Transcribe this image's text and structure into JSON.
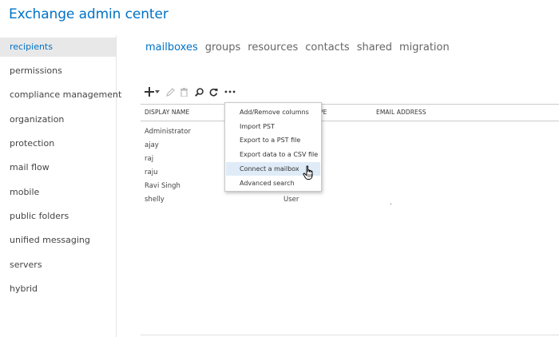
{
  "app": {
    "title": "Exchange admin center"
  },
  "sidebar": {
    "items": [
      {
        "label": "recipients",
        "active": true
      },
      {
        "label": "permissions"
      },
      {
        "label": "compliance management"
      },
      {
        "label": "organization"
      },
      {
        "label": "protection"
      },
      {
        "label": "mail flow"
      },
      {
        "label": "mobile"
      },
      {
        "label": "public folders"
      },
      {
        "label": "unified messaging"
      },
      {
        "label": "servers"
      },
      {
        "label": "hybrid"
      }
    ]
  },
  "tabs": [
    {
      "label": "mailboxes",
      "active": true
    },
    {
      "label": "groups"
    },
    {
      "label": "resources"
    },
    {
      "label": "contacts"
    },
    {
      "label": "shared"
    },
    {
      "label": "migration"
    }
  ],
  "toolbar": {
    "icons": [
      "add-icon",
      "chevron-down-icon",
      "edit-icon",
      "delete-icon",
      "search-icon",
      "refresh-icon",
      "more-options-icon"
    ],
    "more_label": "•••"
  },
  "table": {
    "columns": [
      "DISPLAY NAME",
      "PE",
      "EMAIL ADDRESS"
    ],
    "rows": [
      {
        "name": "Administrator",
        "type": ""
      },
      {
        "name": "ajay",
        "type": ""
      },
      {
        "name": "raj",
        "type": ""
      },
      {
        "name": "raju",
        "type": ""
      },
      {
        "name": "Ravi Singh",
        "type": ""
      },
      {
        "name": "shelly",
        "type": "User"
      }
    ]
  },
  "menu": {
    "items": [
      {
        "label": "Add/Remove columns"
      },
      {
        "label": "Import PST"
      },
      {
        "label": "Export to a PST file"
      },
      {
        "label": "Export data to a CSV file"
      },
      {
        "label": "Connect a mailbox",
        "hover": true
      },
      {
        "label": "Advanced search"
      }
    ]
  },
  "colors": {
    "accent": "#0072c6",
    "sidebar_active_bg": "#e8e8e8",
    "menu_hover_bg": "#dfecf7"
  }
}
